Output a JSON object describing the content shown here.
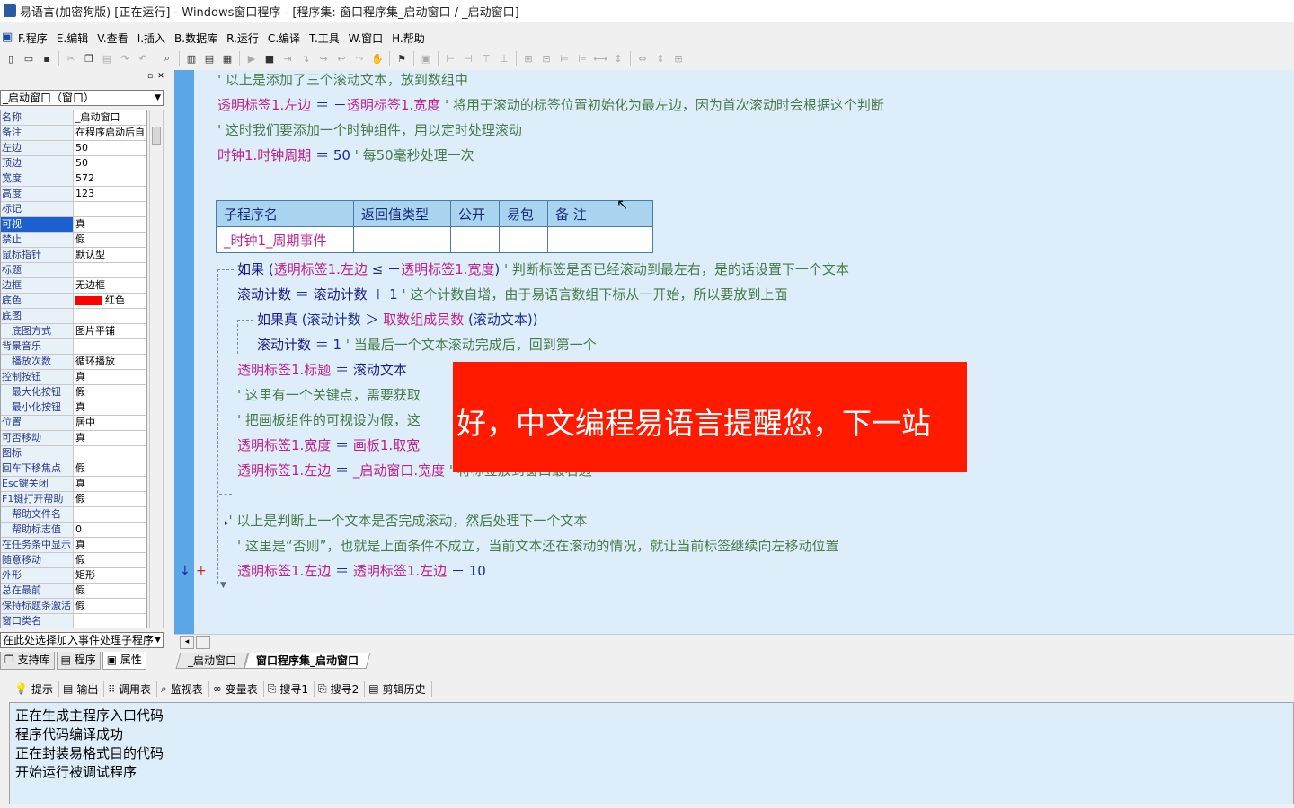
{
  "window": {
    "title": "易语言(加密狗版) [正在运行] - Windows窗口程序 - [程序集: 窗口程序集_启动窗口 / _启动窗口]"
  },
  "menu": [
    "F.程序",
    "E.编辑",
    "V.查看",
    "I.插入",
    "B.数据库",
    "R.运行",
    "C.编译",
    "T.工具",
    "W.窗口",
    "H.帮助"
  ],
  "left_panel": {
    "object_select": "_启动窗口（窗口）",
    "properties": [
      {
        "name": "名称",
        "value": "_启动窗口"
      },
      {
        "name": "备注",
        "value": "在程序启动后自"
      },
      {
        "name": "左边",
        "value": "50"
      },
      {
        "name": "顶边",
        "value": "50"
      },
      {
        "name": "宽度",
        "value": "572"
      },
      {
        "name": "高度",
        "value": "123"
      },
      {
        "name": "标记",
        "value": ""
      },
      {
        "name": "可视",
        "value": "真"
      },
      {
        "name": "禁止",
        "value": "假"
      },
      {
        "name": "鼠标指针",
        "value": "默认型"
      },
      {
        "name": "标题",
        "value": ""
      },
      {
        "name": "边框",
        "value": "无边框"
      },
      {
        "name": "底色",
        "value": "红色"
      },
      {
        "name": "底图",
        "value": ""
      },
      {
        "name": "底图方式",
        "value": "图片平铺"
      },
      {
        "name": "背景音乐",
        "value": ""
      },
      {
        "name": "播放次数",
        "value": "循环播放"
      },
      {
        "name": "控制按钮",
        "value": "真"
      },
      {
        "name": "最大化按钮",
        "value": "假"
      },
      {
        "name": "最小化按钮",
        "value": "真"
      },
      {
        "name": "位置",
        "value": "居中"
      },
      {
        "name": "可否移动",
        "value": "真"
      },
      {
        "name": "图标",
        "value": ""
      },
      {
        "name": "回车下移焦点",
        "value": "假"
      },
      {
        "name": "Esc键关闭",
        "value": "真"
      },
      {
        "name": "F1键打开帮助",
        "value": "假"
      },
      {
        "name": "帮助文件名",
        "value": ""
      },
      {
        "name": "帮助标志值",
        "value": "0"
      },
      {
        "name": "在任务条中显示",
        "value": "真"
      },
      {
        "name": "随意移动",
        "value": "假"
      },
      {
        "name": "外形",
        "value": "矩形"
      },
      {
        "name": "总在最前",
        "value": "假"
      },
      {
        "name": "保持标题条激活",
        "value": "假"
      },
      {
        "name": "窗口类名",
        "value": ""
      }
    ],
    "event_select": "在此处选择加入事件处理子程序",
    "tabs": [
      "支持库",
      "程序",
      "属性"
    ]
  },
  "code": {
    "l1": "' 以上是添加了三个滚动文本，放到数组中",
    "l2a": "透明标签1.左边",
    "l2b": " ＝ －",
    "l2c": "透明标签1.宽度",
    "l2d": "  ' 将用于滚动的标签位置初始化为最左边，因为首次滚动时会根据这个判断",
    "l3": "' 这时我们要添加一个时钟组件，用以定时处理滚动",
    "l4a": "时钟1.时钟周期",
    "l4b": " ＝ 50",
    "l4c": "  ' 每50毫秒处理一次",
    "table_headers": [
      "子程序名",
      "返回值类型",
      "公开",
      "易包",
      "备 注"
    ],
    "sub_name": "_时钟1_周期事件",
    "l5a": "如果",
    "l5b": " (",
    "l5c": "透明标签1.左边",
    "l5d": " ≤ －",
    "l5e": "透明标签1.宽度",
    "l5f": ")",
    "l5g": "  ' 判断标签是否已经滚动到最左右，是的话设置下一个文本",
    "l6a": "滚动计数",
    "l6b": " ＝ ",
    "l6c": "滚动计数",
    "l6d": " ＋ 1",
    "l6e": "  ' 这个计数自增，由于易语言数组下标从一开始，所以要放到上面",
    "l7a": "如果真",
    "l7b": " (滚动计数 ＞ ",
    "l7c": "取数组成员数",
    "l7d": " (滚动文本))",
    "l8a": "滚动计数",
    "l8b": " ＝ 1",
    "l8c": "  ' 当最后一个文本滚动完成后，回到第一个",
    "l9a": "透明标签1.标题",
    "l9b": " ＝ ",
    "l9c": "滚动文本",
    "l10": "' 这里有一个关键点，需要获取",
    "l11": "' 把画板组件的可视设为假，这",
    "l12a": "透明标签1.宽度",
    "l12b": " ＝ ",
    "l12c": "画板1.取宽",
    "l13a": "透明标签1.左边",
    "l13b": " ＝ ",
    "l13c": "_启动窗口.宽度",
    "l13d": "  ' 将标签放到窗口最右边",
    "l14": "' 以上是判断上一个文本是否完成滚动，然后处理下一个文本",
    "l15": "' 这里是“否则”，也就是上面条件不成立，当前文本还在滚动的情况，就让当前标签继续向左移动位置",
    "l16a": "透明标签1.左边",
    "l16b": " ＝ ",
    "l16c": "透明标签1.左边",
    "l16d": " － 10"
  },
  "overlay": {
    "text": "好，中文编程易语言提醒您，下一站",
    "bg_color": "#ff1a00"
  },
  "editor_tabs": [
    "_启动窗口",
    "窗口程序集_启动窗口"
  ],
  "bottom_tabs": [
    {
      "icon": "hint-icon",
      "label": "提示"
    },
    {
      "icon": "output-icon",
      "label": "输出"
    },
    {
      "icon": "calltable-icon",
      "label": "调用表"
    },
    {
      "icon": "monitor-icon",
      "label": "监视表"
    },
    {
      "icon": "variable-icon",
      "label": "变量表"
    },
    {
      "icon": "search1-icon",
      "label": "搜寻1"
    },
    {
      "icon": "search2-icon",
      "label": "搜寻2"
    },
    {
      "icon": "clipboard-icon",
      "label": "剪辑历史"
    }
  ],
  "output_lines": [
    "正在生成主程序入口代码",
    "程序代码编译成功",
    "正在封装易格式目的代码",
    "开始运行被调试程序"
  ]
}
